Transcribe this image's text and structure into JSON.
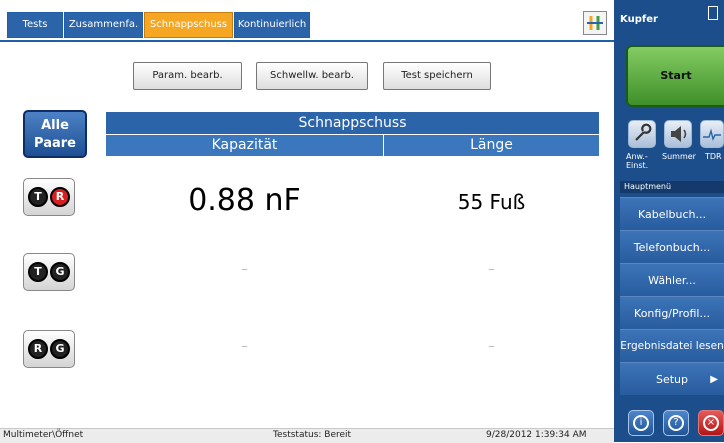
{
  "tabs": [
    {
      "label": "Tests",
      "active": false
    },
    {
      "label": "Zusammenfa.",
      "active": false
    },
    {
      "label": "Schnappschuss",
      "active": true
    },
    {
      "label": "Kontinuierlich",
      "active": false
    }
  ],
  "toolbar": {
    "param_button": "Param. bearb.",
    "threshold_button": "Schwellw. bearb.",
    "save_button": "Test speichern"
  },
  "all_pairs_button": "Alle\nPaare",
  "pairs": [
    {
      "left": "T",
      "right": "R",
      "right_color": "#d81f1f",
      "capacity": "0.88 nF",
      "length": "55 Fuß"
    },
    {
      "left": "T",
      "right": "G",
      "right_color": "#222222",
      "capacity": "–",
      "length": "–"
    },
    {
      "left": "R",
      "right": "G",
      "right_color": "#222222",
      "capacity": "–",
      "length": "–"
    }
  ],
  "table": {
    "title": "Schnappschuss",
    "col_capacity": "Kapazität",
    "col_length": "Länge"
  },
  "statusbar": {
    "left": "Multimeter\\Öffnet",
    "center": "Teststatus: Bereit",
    "right": "9/28/2012 1:39:34 AM"
  },
  "right_panel": {
    "title": "Kupfer",
    "start_label": "Start",
    "tools": [
      "Anw.- Einst.",
      "Summer",
      "TDR"
    ],
    "menu_header": "Hauptmenü",
    "menu_items": [
      "Kabelbuch...",
      "Telefonbuch...",
      "Wähler...",
      "Konfig/Profil...",
      "Ergebnisdatei lesen",
      "Setup"
    ]
  },
  "colors": {
    "accent": "#2b64a9",
    "active_tab": "#f5a623",
    "start_green": "#4f9f35",
    "close_red": "#d81f1f"
  }
}
